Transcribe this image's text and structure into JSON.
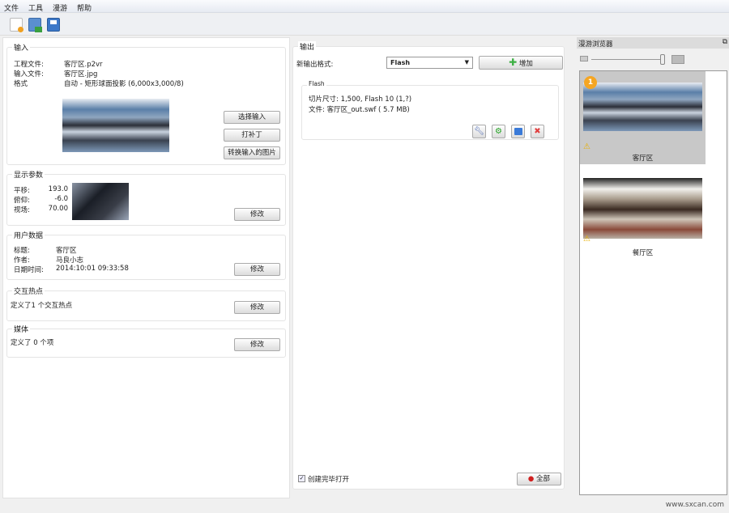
{
  "menu": [
    "文件",
    "工具",
    "漫游",
    "帮助"
  ],
  "input": {
    "title": "输入",
    "rows": [
      {
        "label": "工程文件:",
        "value": "客厅区.p2vr"
      },
      {
        "label": "输入文件:",
        "value": "客厅区.jpg"
      },
      {
        "label": "格式",
        "value": "自动 - 矩形球面投影 (6,000x3,000/8)"
      }
    ],
    "buttons": [
      "选择输入",
      "打补丁",
      "转换输入的图片"
    ]
  },
  "view": {
    "title": "显示参数",
    "rows": [
      {
        "label": "平移:",
        "value": "193.0"
      },
      {
        "label": "俯仰:",
        "value": "-6.0"
      },
      {
        "label": "视场:",
        "value": "70.00"
      }
    ],
    "button": "修改"
  },
  "user": {
    "title": "用户数据",
    "rows": [
      {
        "label": "标题:",
        "value": "客厅区"
      },
      {
        "label": "作者:",
        "value": "马良小志"
      },
      {
        "label": "日期时间:",
        "value": "2014:10:01 09:33:58"
      }
    ],
    "button": "修改"
  },
  "hotspots": {
    "title": "交互热点",
    "text": "定义了1 个交互热点",
    "button": "修改"
  },
  "media": {
    "title": "媒体",
    "text": "定义了 0 个项",
    "button": "修改"
  },
  "output": {
    "title": "输出",
    "format_label": "新输出格式:",
    "format_value": "Flash",
    "add_button": "增加",
    "item": {
      "title": "Flash",
      "line1": "切片尺寸: 1,500, Flash 10 (1,?)",
      "line2": "文件: 客厅区_out.swf (      5.7 MB)"
    },
    "open_checkbox": "创建完毕打开",
    "open_checked": true,
    "all_button": "全部"
  },
  "browser": {
    "title": "漫游浏览器",
    "zoom_level": 0.95,
    "items": [
      {
        "label": "客厅区",
        "badge": "1",
        "selected": true
      },
      {
        "label": "餐厅区",
        "selected": false
      }
    ]
  },
  "status": "www.sxcan.com"
}
